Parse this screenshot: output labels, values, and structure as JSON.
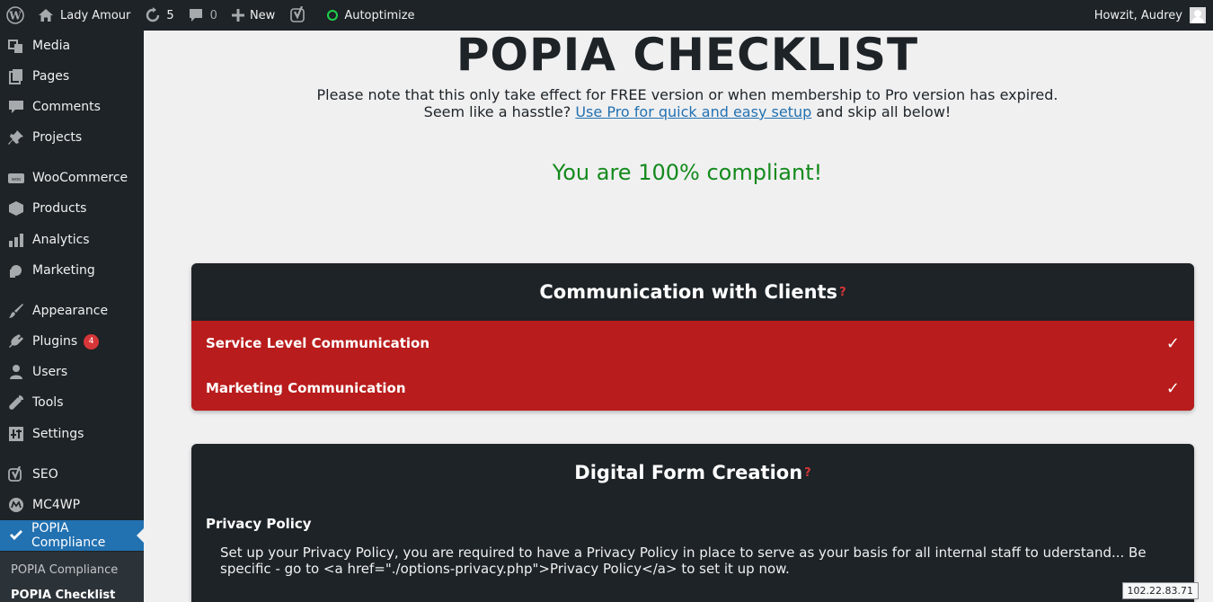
{
  "adminbar": {
    "site_name": "Lady Amour",
    "updates_count": "5",
    "comments_count": "0",
    "new_label": "New",
    "autoptimize_label": "Autoptimize",
    "greeting": "Howzit, Audrey"
  },
  "sidebar": {
    "items": [
      {
        "label": "Media",
        "icon": "media-icon"
      },
      {
        "label": "Pages",
        "icon": "pages-icon"
      },
      {
        "label": "Comments",
        "icon": "comments-icon"
      },
      {
        "label": "Projects",
        "icon": "pin-icon"
      },
      {
        "label": "WooCommerce",
        "icon": "woocommerce-icon"
      },
      {
        "label": "Products",
        "icon": "products-icon"
      },
      {
        "label": "Analytics",
        "icon": "analytics-icon"
      },
      {
        "label": "Marketing",
        "icon": "megaphone-icon"
      },
      {
        "label": "Appearance",
        "icon": "brush-icon"
      },
      {
        "label": "Plugins",
        "icon": "plugin-icon",
        "badge": "4"
      },
      {
        "label": "Users",
        "icon": "users-icon"
      },
      {
        "label": "Tools",
        "icon": "wrench-icon"
      },
      {
        "label": "Settings",
        "icon": "settings-icon"
      },
      {
        "label": "SEO",
        "icon": "yoast-icon"
      },
      {
        "label": "MC4WP",
        "icon": "mc4wp-icon"
      },
      {
        "label": "POPIA Compliance",
        "icon": "check-icon"
      }
    ],
    "submenu": [
      "POPIA Compliance",
      "POPIA Checklist"
    ]
  },
  "main": {
    "title": "POPIA CHECKLIST",
    "note_line1": "Please note that this only take effect for FREE version or when membership to Pro version has expired.",
    "note_line2_pre": "Seem like a hasstle? ",
    "note_link": "Use Pro for quick and easy setup",
    "note_line2_post": " and skip all below!",
    "compliant_text": "You are 100% compliant!",
    "cards": [
      {
        "title": "Communication with Clients",
        "help": "?",
        "rows": [
          {
            "label": "Service Level Communication",
            "status": "✓"
          },
          {
            "label": "Marketing Communication",
            "status": "✓"
          }
        ]
      },
      {
        "title": "Digital Form Creation",
        "help": "?",
        "section_title": "Privacy Policy",
        "section_desc": "Set up your Privacy Policy, you are required to have a Privacy Policy in place to serve as your basis for all internal staff to uderstand... Be specific - go to <a href=\"./options-privacy.php\">Privacy Policy</a> to set it up now."
      }
    ]
  },
  "ip_tooltip": "102.22.83.71",
  "colors": {
    "admin_dark": "#1d2327",
    "accent_blue": "#2271b1",
    "row_red": "#b91c1c",
    "compliant_green": "#138a1c"
  }
}
